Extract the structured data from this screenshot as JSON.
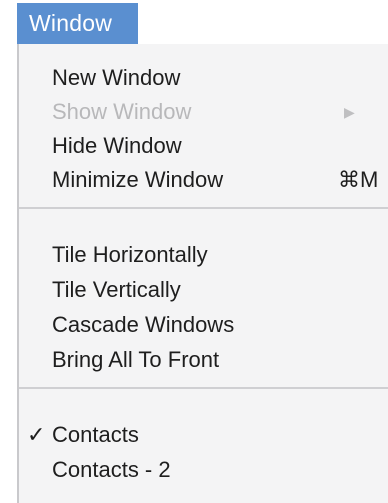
{
  "menubar": {
    "title": "Window",
    "highlight_color": "#5a8fd0"
  },
  "menu": {
    "items": [
      {
        "label": "New Window",
        "enabled": true
      },
      {
        "label": "Show Window",
        "enabled": false,
        "submenu_icon": "chevron-right-icon",
        "submenu_glyph": "▶"
      },
      {
        "label": "Hide Window",
        "enabled": true
      },
      {
        "label": "Minimize Window",
        "enabled": true,
        "shortcut": "⌘M"
      },
      {
        "label": "Tile Horizontally",
        "enabled": true
      },
      {
        "label": "Tile Vertically",
        "enabled": true
      },
      {
        "label": "Cascade Windows",
        "enabled": true
      },
      {
        "label": "Bring All To Front",
        "enabled": true
      },
      {
        "label": "Contacts",
        "enabled": true,
        "checked": true,
        "check_glyph": "✓"
      },
      {
        "label": "Contacts - 2",
        "enabled": true
      }
    ]
  }
}
